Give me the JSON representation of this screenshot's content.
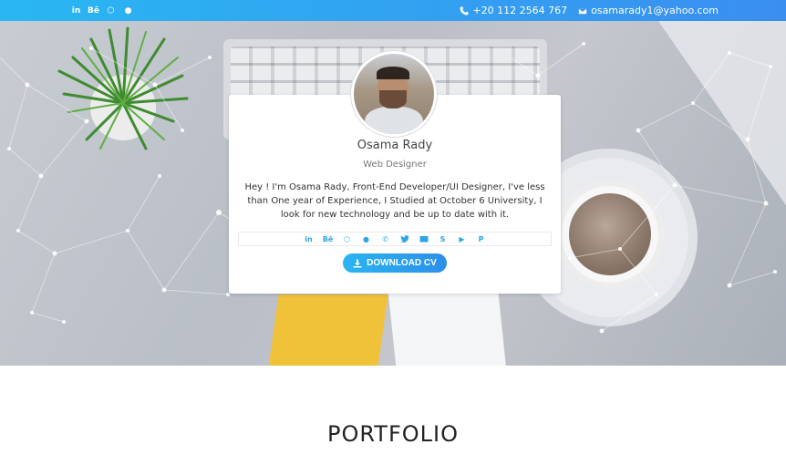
{
  "topbar": {
    "social_icons": [
      {
        "icon": "linkedin-icon",
        "glyph": "in"
      },
      {
        "icon": "behance-icon",
        "glyph": "Bē"
      },
      {
        "icon": "codepen-icon",
        "glyph": "⬡"
      },
      {
        "icon": "github-icon",
        "glyph": "●"
      }
    ],
    "phone": "+20 112 2564 767",
    "email": "osamarady1@yahoo.com"
  },
  "profile": {
    "name": "Osama Rady",
    "role": "Web Designer",
    "bio": "Hey ! I'm Osama Rady, Front-End Developer/UI Designer, I've less than One year of Experience, I Studied at October 6 University, I look for new technology and be up to date with it.",
    "icons": [
      {
        "name": "linkedin-icon",
        "glyph": "in"
      },
      {
        "name": "behance-icon",
        "glyph": "Bē"
      },
      {
        "name": "codepen-icon",
        "glyph": "⬡"
      },
      {
        "name": "github-icon",
        "glyph": "●"
      },
      {
        "name": "whatsapp-icon",
        "glyph": "✆"
      },
      {
        "name": "twitter-icon",
        "glyph": "🐦"
      },
      {
        "name": "mail-icon",
        "glyph": "✉"
      },
      {
        "name": "skype-icon",
        "glyph": "S"
      },
      {
        "name": "youtube-icon",
        "glyph": "▶"
      },
      {
        "name": "pinterest-icon",
        "glyph": "P"
      }
    ],
    "download_label": "DOWNLOAD CV"
  },
  "section": {
    "title": "PORTFOLIO"
  },
  "colors": {
    "accent": "#2aa6e6",
    "topbar_start": "#29b7f2",
    "topbar_end": "#3a8ef0"
  }
}
